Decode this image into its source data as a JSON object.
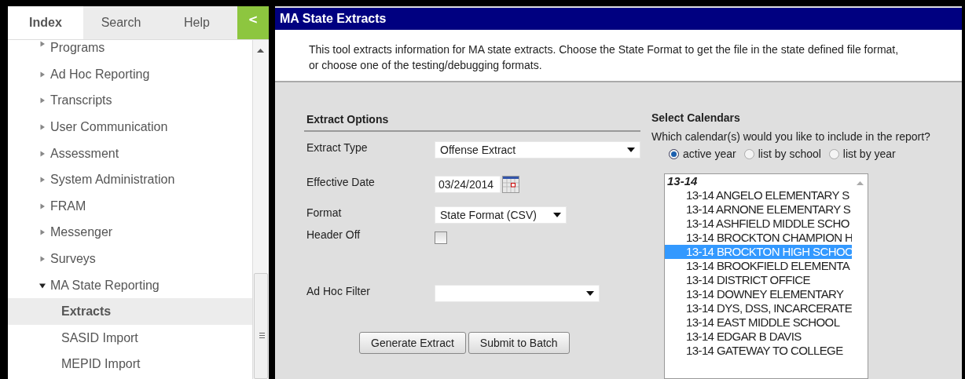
{
  "sidebar": {
    "tabs": [
      {
        "label": "Index",
        "selected": true
      },
      {
        "label": "Search",
        "selected": false
      },
      {
        "label": "Help",
        "selected": false
      }
    ],
    "collapse_button": "<",
    "items": [
      {
        "label": "Programs",
        "expanded": false
      },
      {
        "label": "Ad Hoc Reporting",
        "expanded": false
      },
      {
        "label": "Transcripts",
        "expanded": false
      },
      {
        "label": "User Communication",
        "expanded": false
      },
      {
        "label": "Assessment",
        "expanded": false
      },
      {
        "label": "System Administration",
        "expanded": false
      },
      {
        "label": "FRAM",
        "expanded": false
      },
      {
        "label": "Messenger",
        "expanded": false
      },
      {
        "label": "Surveys",
        "expanded": false
      },
      {
        "label": "MA State Reporting",
        "expanded": true,
        "children": [
          {
            "label": "Extracts",
            "selected": true
          },
          {
            "label": "SASID Import",
            "selected": false
          },
          {
            "label": "MEPID Import",
            "selected": false
          }
        ]
      }
    ]
  },
  "panel": {
    "title": "MA State Extracts",
    "description": "This tool extracts information for MA state extracts. Choose the State Format to get the file in the state defined file format, or choose one of the testing/debugging formats."
  },
  "extract_options": {
    "heading": "Extract Options",
    "fields": [
      {
        "kind": "select",
        "label": "Extract Type",
        "value": "Offense Extract"
      },
      {
        "kind": "date",
        "label": "Effective Date",
        "value": "03/24/2014"
      },
      {
        "kind": "select",
        "label": "Format",
        "value": "State Format (CSV)"
      },
      {
        "kind": "checkbox",
        "label": "Header Off",
        "checked": false
      },
      {
        "kind": "select",
        "label": "Ad Hoc Filter"
      }
    ],
    "buttons": [
      "Generate Extract",
      "Submit to Batch"
    ]
  },
  "calendars": {
    "heading": "Select Calendars",
    "question": "Which calendar(s) would you like to include in the report?",
    "options": [
      {
        "label": "active year",
        "selected": true
      },
      {
        "label": "list by school",
        "selected": false
      },
      {
        "label": "list by year",
        "selected": false
      }
    ],
    "group": "13-14",
    "items": [
      {
        "label": "13-14 ANGELO ELEMENTARY S",
        "selected": false
      },
      {
        "label": "13-14 ARNONE ELEMENTARY S",
        "selected": false
      },
      {
        "label": "13-14 ASHFIELD MIDDLE SCHO",
        "selected": false
      },
      {
        "label": "13-14 BROCKTON CHAMPION H",
        "selected": false
      },
      {
        "label": "13-14 BROCKTON HIGH SCHOO",
        "selected": true
      },
      {
        "label": "13-14 BROOKFIELD ELEMENTA",
        "selected": false
      },
      {
        "label": "13-14 DISTRICT OFFICE",
        "selected": false
      },
      {
        "label": "13-14 DOWNEY ELEMENTARY",
        "selected": false
      },
      {
        "label": "13-14 DYS, DSS, INCARCERATE",
        "selected": false
      },
      {
        "label": "13-14 EAST MIDDLE SCHOOL",
        "selected": false
      },
      {
        "label": "13-14 EDGAR B DAVIS",
        "selected": false
      },
      {
        "label": "13-14 GATEWAY TO COLLEGE",
        "selected": false
      }
    ]
  }
}
